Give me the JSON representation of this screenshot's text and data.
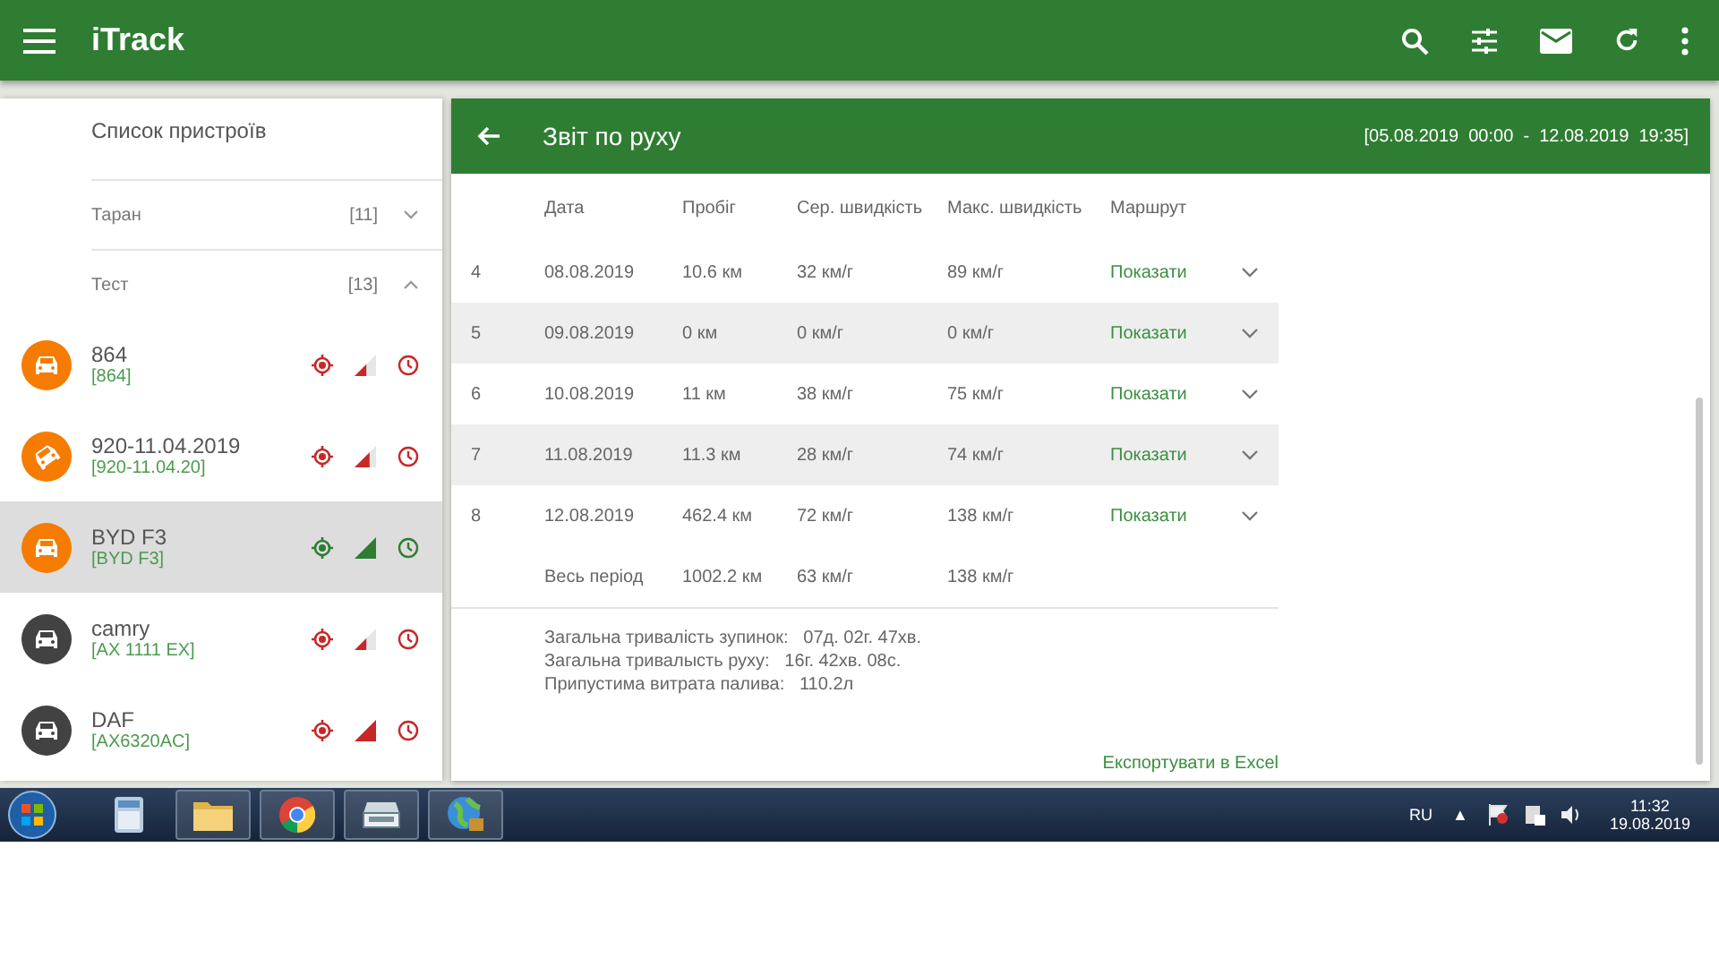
{
  "app_bar": {
    "title": "iTrack"
  },
  "sidebar": {
    "title": "Список пристроїв",
    "groups": [
      {
        "name": "Таран",
        "count": "[11]",
        "expanded": false
      },
      {
        "name": "Тест",
        "count": "[13]",
        "expanded": true,
        "children": [
          {
            "name": "864",
            "plate": "[864]",
            "color": "#f57c00",
            "kind": "car",
            "online": false,
            "level": 0.55,
            "selected": false
          },
          {
            "name": "920-11.04.2019",
            "plate": "[920-11.04.20]",
            "color": "#f57c00",
            "kind": "car-tilted",
            "online": false,
            "level": 0.7,
            "selected": false
          },
          {
            "name": "BYD F3",
            "plate": "[BYD F3]",
            "color": "#f57c00",
            "kind": "car",
            "online": true,
            "level": 1,
            "selected": true
          },
          {
            "name": "camry",
            "plate": "[AX 1111 EX]",
            "color": "#424242",
            "kind": "car",
            "online": false,
            "level": 0.55,
            "selected": false
          },
          {
            "name": "DAF",
            "plate": "[AX6320AC]",
            "color": "#424242",
            "kind": "car",
            "online": false,
            "level": 1,
            "selected": false
          }
        ]
      }
    ]
  },
  "report": {
    "title": "Звіт по руху",
    "period": "[05.08.2019  00:00  -  12.08.2019  19:35]",
    "columns": [
      "Дата",
      "Пробіг",
      "Сер. швидкість",
      "Макс. швидкість",
      "Маршрут"
    ],
    "rows": [
      {
        "n": "4",
        "date": "08.08.2019",
        "distance": "10.6 км",
        "avg": "32 км/г",
        "max": "89 км/г",
        "route": "Показати"
      },
      {
        "n": "5",
        "date": "09.08.2019",
        "distance": "0 км",
        "avg": "0 км/г",
        "max": "0 км/г",
        "route": "Показати"
      },
      {
        "n": "6",
        "date": "10.08.2019",
        "distance": "11 км",
        "avg": "38 км/г",
        "max": "75 км/г",
        "route": "Показати"
      },
      {
        "n": "7",
        "date": "11.08.2019",
        "distance": "11.3 км",
        "avg": "28 км/г",
        "max": "74 км/г",
        "route": "Показати"
      },
      {
        "n": "8",
        "date": "12.08.2019",
        "distance": "462.4 км",
        "avg": "72 км/г",
        "max": "138 км/г",
        "route": "Показати"
      }
    ],
    "total": {
      "label": "Весь період",
      "distance": "1002.2 км",
      "avg": "63 км/г",
      "max": "138 км/г"
    },
    "summary": [
      {
        "label": "Загальна тривалість зупинок:",
        "value": "07д. 02г. 47хв."
      },
      {
        "label": "Загальна тривалысть руху:",
        "value": "16г. 42хв. 08с."
      },
      {
        "label": "Припустима витрата палива:",
        "value": "110.2л"
      }
    ],
    "export": "Експортувати в Excel"
  },
  "taskbar": {
    "apps": [
      {
        "kind": "calculator",
        "running": false
      },
      {
        "kind": "folder",
        "running": true
      },
      {
        "kind": "chrome",
        "running": true
      },
      {
        "kind": "scanner",
        "running": true
      },
      {
        "kind": "globe",
        "running": true
      }
    ],
    "language": "RU",
    "tray_arrow": "▲",
    "time": "11:32",
    "date": "19.08.2019"
  }
}
